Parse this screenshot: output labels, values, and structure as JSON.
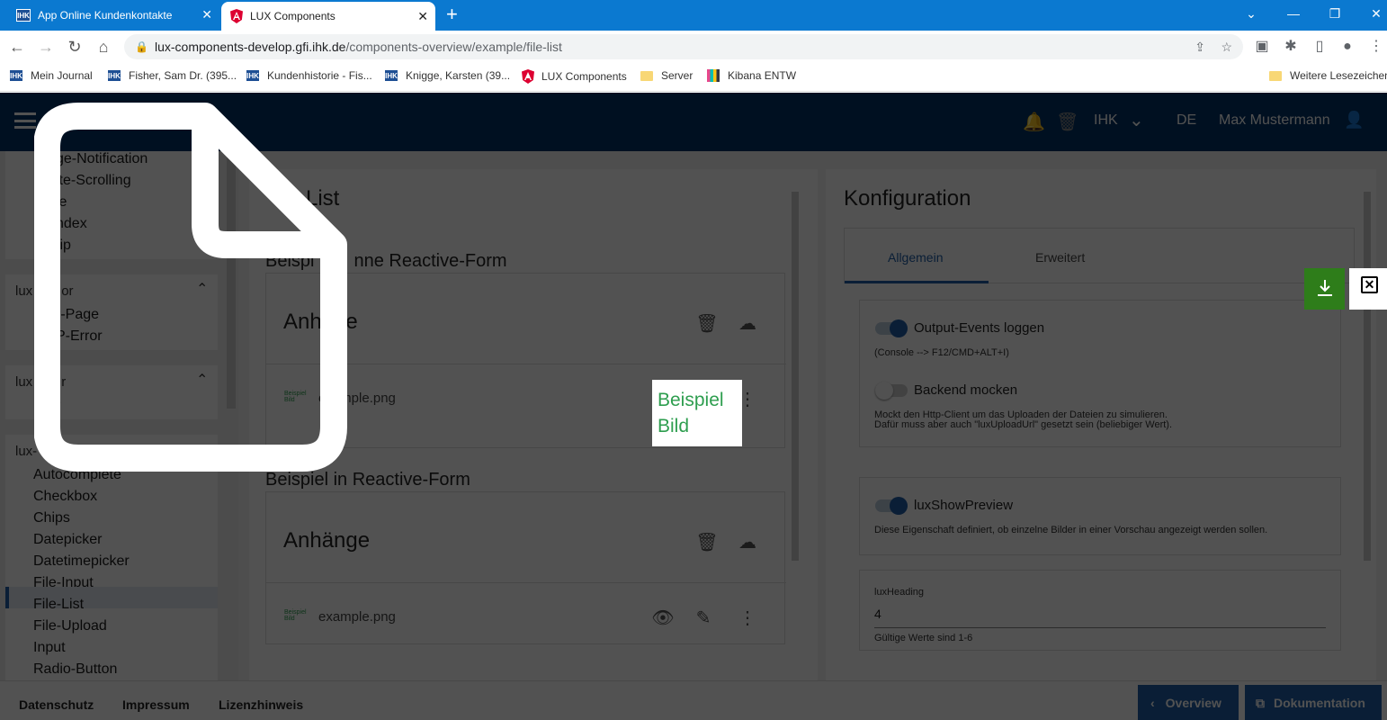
{
  "browser": {
    "tabs": [
      {
        "title": "App Online Kundenkontakte",
        "favicon": "IHK"
      },
      {
        "title": "LUX Components",
        "favicon": "angular-icon"
      }
    ],
    "new_tab": "+",
    "url_host": "lux-components-develop.gfi.ihk.de",
    "url_path": "/components-overview/example/file-list",
    "bookmarks": [
      {
        "label": "Mein Journal",
        "icon": "IHK"
      },
      {
        "label": "Fisher, Sam Dr. (395...",
        "icon": "IHK"
      },
      {
        "label": "Kundenhistorie - Fis...",
        "icon": "IHK"
      },
      {
        "label": "Knigge, Karsten (39...",
        "icon": "IHK"
      },
      {
        "label": "LUX Components",
        "icon": "angular-icon"
      },
      {
        "label": "Server",
        "icon": "folder-icon"
      },
      {
        "label": "Kibana ENTW",
        "icon": "kibana-icon"
      },
      {
        "label": "Weitere Lesezeichen",
        "icon": "folder-icon"
      }
    ]
  },
  "header": {
    "org": "IHK",
    "lang": "DE",
    "user": "Max Mustermann"
  },
  "sidebar": {
    "group1_items": [
      "ge-Notification",
      "ite-Scrolling",
      "le",
      "ndex",
      "tip"
    ],
    "group2_title": "lux",
    "group2_title_suffix": "or",
    "group2_items": [
      "r-Page",
      "P-Error"
    ],
    "group3_title": "lux",
    "group3_title_suffix": "r",
    "group3_items": [
      "r"
    ],
    "group4_title": "lux-",
    "group4_items": [
      "Autocomplete",
      "Checkbox",
      "Chips",
      "Datepicker",
      "Datetimepicker",
      "File-Input",
      "File-List",
      "File-Upload",
      "Input",
      "Radio-Button"
    ]
  },
  "main": {
    "title": "List",
    "section1_title": "Beispi",
    "section1_title_b": "nne Reactive-Form",
    "section1_box_title": "Anh",
    "section1_box_title_b": "nge",
    "section1_file": "example.png",
    "section2_title": "Beispiel in Reactive-Form",
    "section2_box_title": "Anhänge",
    "section2_file": "example.png",
    "thumb_label": "Beispiel Bild"
  },
  "config": {
    "title": "Konfiguration",
    "tabs": [
      "Allgemein",
      "Erweitert"
    ],
    "opt1_label": "Output-Events loggen",
    "opt1_hint": "(Console --> F12/CMD+ALT+I)",
    "opt2_label": "Backend mocken",
    "opt2_hint1": "Mockt den Http-Client um das Uploaden der Dateien zu simulieren.",
    "opt2_hint2": "Dafür muss aber auch \"luxUploadUrl\" gesetzt sein (beliebiger Wert).",
    "opt3_label": "luxShowPreview",
    "opt3_hint": "Diese Eigenschaft definiert, ob einzelne Bilder in einer Vorschau angezeigt werden sollen.",
    "heading_label": "luxHeading",
    "heading_value": "4",
    "heading_hint": "Gültige Werte sind 1-6"
  },
  "footer": {
    "links": [
      "Datenschutz",
      "Impressum",
      "Lizenzhinweis"
    ],
    "overview": "Overview",
    "doc": "Dokumentation"
  },
  "preview": {
    "text_line1": "Beispiel",
    "text_line2": "Bild"
  },
  "colors": {
    "tabstrip": "#0b79d0",
    "app_header": "#003366",
    "download": "#2e7d1a",
    "preview_text": "#2e9e4f"
  }
}
